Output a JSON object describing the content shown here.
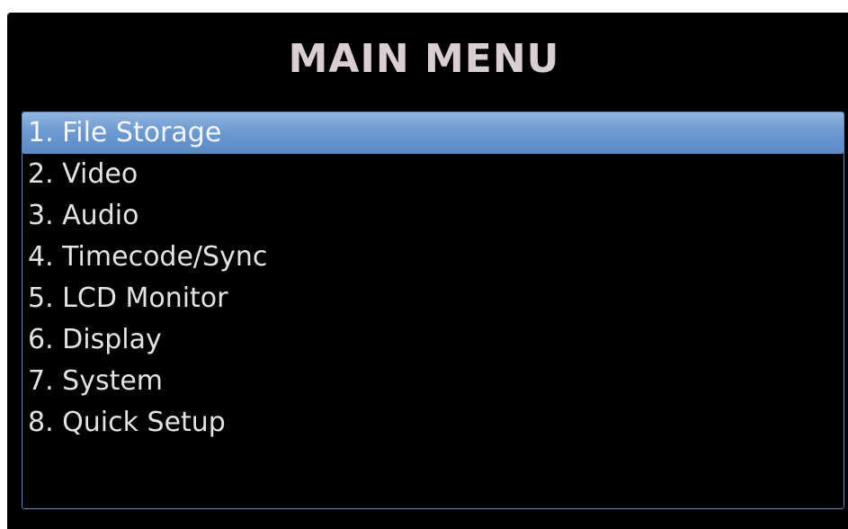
{
  "menu": {
    "title": "MAIN MENU",
    "items": [
      {
        "label": "1. File Storage",
        "selected": true
      },
      {
        "label": "2. Video",
        "selected": false
      },
      {
        "label": "3. Audio",
        "selected": false
      },
      {
        "label": "4. Timecode/Sync",
        "selected": false
      },
      {
        "label": "5. LCD Monitor",
        "selected": false
      },
      {
        "label": "6. Display",
        "selected": false
      },
      {
        "label": "7. System",
        "selected": false
      },
      {
        "label": "8. Quick Setup",
        "selected": false
      }
    ]
  },
  "colors": {
    "background": "#000000",
    "title": "#d9cfd3",
    "item_text": "#e6e2e4",
    "selection": "#6d9ad0",
    "frame_border": "#5a86b8"
  }
}
